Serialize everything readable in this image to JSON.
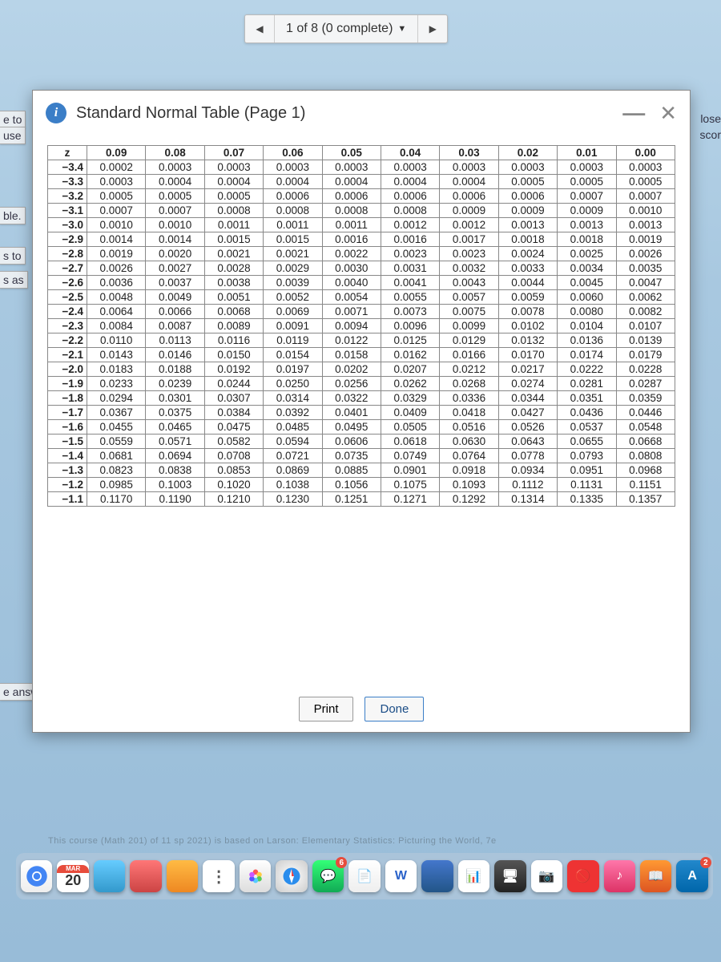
{
  "pager": {
    "label": "1 of 8 (0 complete)"
  },
  "left_fragments": {
    "a": "e to",
    "b": "use",
    "c": "ble.",
    "d": "s to",
    "e": "s as",
    "f": "e answe"
  },
  "right_fragments": {
    "a": "lose",
    "b": "scor"
  },
  "modal": {
    "title": "Standard Normal Table (Page 1)",
    "print": "Print",
    "done": "Done"
  },
  "chart_data": {
    "type": "table",
    "title": "Standard Normal Table (Page 1)",
    "columns": [
      "z",
      "0.09",
      "0.08",
      "0.07",
      "0.06",
      "0.05",
      "0.04",
      "0.03",
      "0.02",
      "0.01",
      "0.00"
    ],
    "rows": [
      [
        "−3.4",
        "0.0002",
        "0.0003",
        "0.0003",
        "0.0003",
        "0.0003",
        "0.0003",
        "0.0003",
        "0.0003",
        "0.0003",
        "0.0003"
      ],
      [
        "−3.3",
        "0.0003",
        "0.0004",
        "0.0004",
        "0.0004",
        "0.0004",
        "0.0004",
        "0.0004",
        "0.0005",
        "0.0005",
        "0.0005"
      ],
      [
        "−3.2",
        "0.0005",
        "0.0005",
        "0.0005",
        "0.0006",
        "0.0006",
        "0.0006",
        "0.0006",
        "0.0006",
        "0.0007",
        "0.0007"
      ],
      [
        "−3.1",
        "0.0007",
        "0.0007",
        "0.0008",
        "0.0008",
        "0.0008",
        "0.0008",
        "0.0009",
        "0.0009",
        "0.0009",
        "0.0010"
      ],
      [
        "−3.0",
        "0.0010",
        "0.0010",
        "0.0011",
        "0.0011",
        "0.0011",
        "0.0012",
        "0.0012",
        "0.0013",
        "0.0013",
        "0.0013"
      ],
      [
        "−2.9",
        "0.0014",
        "0.0014",
        "0.0015",
        "0.0015",
        "0.0016",
        "0.0016",
        "0.0017",
        "0.0018",
        "0.0018",
        "0.0019"
      ],
      [
        "−2.8",
        "0.0019",
        "0.0020",
        "0.0021",
        "0.0021",
        "0.0022",
        "0.0023",
        "0.0023",
        "0.0024",
        "0.0025",
        "0.0026"
      ],
      [
        "−2.7",
        "0.0026",
        "0.0027",
        "0.0028",
        "0.0029",
        "0.0030",
        "0.0031",
        "0.0032",
        "0.0033",
        "0.0034",
        "0.0035"
      ],
      [
        "−2.6",
        "0.0036",
        "0.0037",
        "0.0038",
        "0.0039",
        "0.0040",
        "0.0041",
        "0.0043",
        "0.0044",
        "0.0045",
        "0.0047"
      ],
      [
        "−2.5",
        "0.0048",
        "0.0049",
        "0.0051",
        "0.0052",
        "0.0054",
        "0.0055",
        "0.0057",
        "0.0059",
        "0.0060",
        "0.0062"
      ],
      [
        "−2.4",
        "0.0064",
        "0.0066",
        "0.0068",
        "0.0069",
        "0.0071",
        "0.0073",
        "0.0075",
        "0.0078",
        "0.0080",
        "0.0082"
      ],
      [
        "−2.3",
        "0.0084",
        "0.0087",
        "0.0089",
        "0.0091",
        "0.0094",
        "0.0096",
        "0.0099",
        "0.0102",
        "0.0104",
        "0.0107"
      ],
      [
        "−2.2",
        "0.0110",
        "0.0113",
        "0.0116",
        "0.0119",
        "0.0122",
        "0.0125",
        "0.0129",
        "0.0132",
        "0.0136",
        "0.0139"
      ],
      [
        "−2.1",
        "0.0143",
        "0.0146",
        "0.0150",
        "0.0154",
        "0.0158",
        "0.0162",
        "0.0166",
        "0.0170",
        "0.0174",
        "0.0179"
      ],
      [
        "−2.0",
        "0.0183",
        "0.0188",
        "0.0192",
        "0.0197",
        "0.0202",
        "0.0207",
        "0.0212",
        "0.0217",
        "0.0222",
        "0.0228"
      ],
      [
        "−1.9",
        "0.0233",
        "0.0239",
        "0.0244",
        "0.0250",
        "0.0256",
        "0.0262",
        "0.0268",
        "0.0274",
        "0.0281",
        "0.0287"
      ],
      [
        "−1.8",
        "0.0294",
        "0.0301",
        "0.0307",
        "0.0314",
        "0.0322",
        "0.0329",
        "0.0336",
        "0.0344",
        "0.0351",
        "0.0359"
      ],
      [
        "−1.7",
        "0.0367",
        "0.0375",
        "0.0384",
        "0.0392",
        "0.0401",
        "0.0409",
        "0.0418",
        "0.0427",
        "0.0436",
        "0.0446"
      ],
      [
        "−1.6",
        "0.0455",
        "0.0465",
        "0.0475",
        "0.0485",
        "0.0495",
        "0.0505",
        "0.0516",
        "0.0526",
        "0.0537",
        "0.0548"
      ],
      [
        "−1.5",
        "0.0559",
        "0.0571",
        "0.0582",
        "0.0594",
        "0.0606",
        "0.0618",
        "0.0630",
        "0.0643",
        "0.0655",
        "0.0668"
      ],
      [
        "−1.4",
        "0.0681",
        "0.0694",
        "0.0708",
        "0.0721",
        "0.0735",
        "0.0749",
        "0.0764",
        "0.0778",
        "0.0793",
        "0.0808"
      ],
      [
        "−1.3",
        "0.0823",
        "0.0838",
        "0.0853",
        "0.0869",
        "0.0885",
        "0.0901",
        "0.0918",
        "0.0934",
        "0.0951",
        "0.0968"
      ],
      [
        "−1.2",
        "0.0985",
        "0.1003",
        "0.1020",
        "0.1038",
        "0.1056",
        "0.1075",
        "0.1093",
        "0.1112",
        "0.1131",
        "0.1151"
      ],
      [
        "−1.1",
        "0.1170",
        "0.1190",
        "0.1210",
        "0.1230",
        "0.1251",
        "0.1271",
        "0.1292",
        "0.1314",
        "0.1335",
        "0.1357"
      ]
    ]
  },
  "calendar": {
    "month": "MAR",
    "day": "20"
  },
  "dock_letters": [
    "W"
  ]
}
